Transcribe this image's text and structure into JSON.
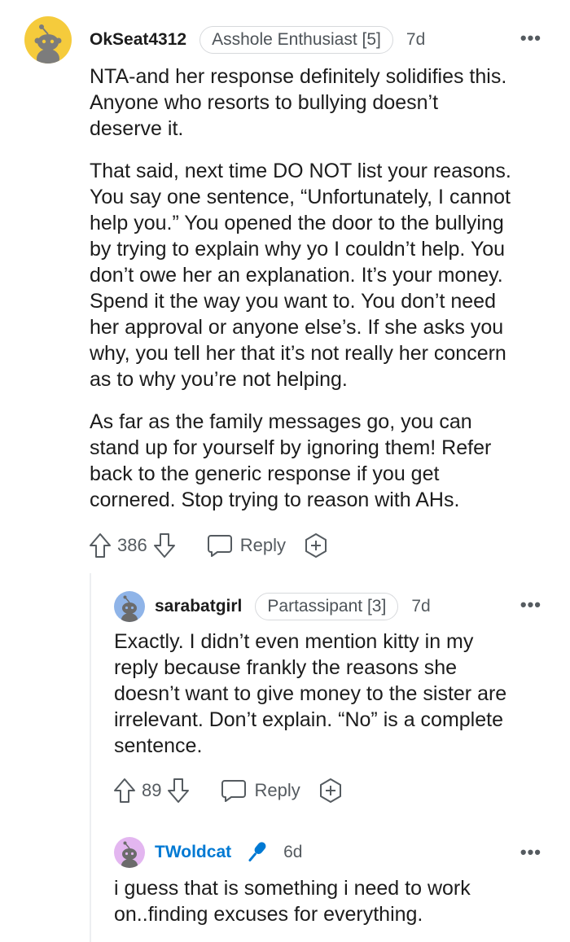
{
  "comments": [
    {
      "username": "OkSeat4312",
      "flair": "Asshole Enthusiast [5]",
      "time": "7d",
      "more": "•••",
      "paragraphs": [
        "NTA-and her response definitely solidifies this.\nAnyone who resorts to bullying doesn’t\ndeserve it.",
        "That said, next time DO NOT list your reasons.\nYou say one sentence, “Unfortunately, I cannot\nhelp you.” You opened the door to the bullying\nby trying to explain why yo I couldn’t help. You\ndon’t owe her an explanation. It’s your money.\nSpend it the way you want to. You don’t need\nher approval or anyone else’s. If she asks you\nwhy, you tell her that it’s not really her concern\nas to why you’re not helping.",
        "As far as the family messages go, you can\nstand up for yourself by ignoring them! Refer\nback to the generic response if you get\ncornered. Stop trying to reason with AHs."
      ],
      "score": "386",
      "reply_label": "Reply",
      "avatar_color": "#f5cb3c"
    },
    {
      "username": "sarabatgirl",
      "flair": "Partassipant [3]",
      "time": "7d",
      "more": "•••",
      "paragraphs": [
        "Exactly. I didn’t even mention kitty in my\nreply because frankly the reasons she\ndoesn’t want to give money to the sister are\nirrelevant. Don’t explain. “No” is a complete\nsentence."
      ],
      "score": "89",
      "reply_label": "Reply",
      "avatar_color": "#8fb4e8"
    },
    {
      "username": "TWoldcat",
      "time": "6d",
      "more": "•••",
      "paragraphs": [
        "i guess that is something i need to work\non..finding excuses for everything."
      ],
      "avatar_color": "#e3b6f0",
      "op_icon": "microphone-icon"
    }
  ],
  "colors": {
    "op_blue": "#0079d3",
    "meta_gray": "#555b60",
    "flair_border": "#d7d9dc"
  }
}
